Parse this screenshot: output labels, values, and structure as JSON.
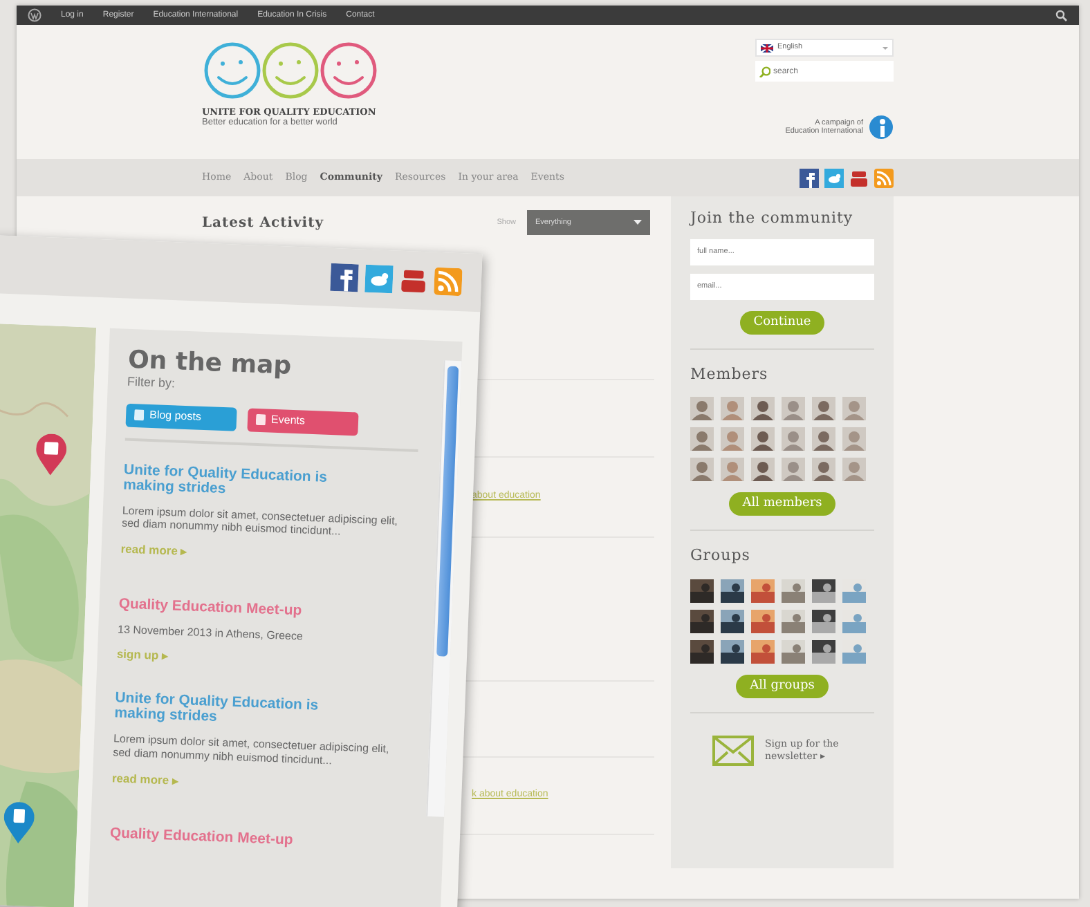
{
  "top_bar": {
    "links": [
      "Log in",
      "Register",
      "Education International",
      "Education In Crisis",
      "Contact"
    ]
  },
  "header": {
    "logo_title": "UNITE FOR QUALITY EDUCATION",
    "logo_tagline": "Better education for a better world",
    "language": "English",
    "search": {
      "placeholder": "search"
    },
    "campaign": [
      "A campaign of",
      "Education International"
    ]
  },
  "nav": [
    {
      "label": "Home",
      "selected": false
    },
    {
      "label": "About",
      "selected": false
    },
    {
      "label": "Blog",
      "selected": false
    },
    {
      "label": "Community",
      "selected": true
    },
    {
      "label": "Resources",
      "selected": false
    },
    {
      "label": "In your area",
      "selected": false
    },
    {
      "label": "Events",
      "selected": false
    }
  ],
  "main": {
    "title": "Latest Activity",
    "show_label": "Show",
    "show_value": "Everything",
    "activity": [
      {
        "text": "about education"
      },
      {
        "text": "k about education"
      }
    ]
  },
  "sidebar": {
    "join": {
      "title": "Join the community",
      "fields": [
        {
          "placeholder": "full name..."
        },
        {
          "placeholder": "email..."
        }
      ],
      "button": "Continue"
    },
    "members": {
      "title": "Members",
      "avatars": [
        {
          "kind": "avatar"
        },
        {
          "kind": "avatar"
        },
        {
          "kind": "avatar"
        },
        {
          "kind": "avatar"
        },
        {
          "kind": "avatar"
        },
        {
          "kind": "avatar"
        },
        {
          "kind": "avatar"
        },
        {
          "kind": "avatar"
        },
        {
          "kind": "avatar"
        },
        {
          "kind": "avatar"
        },
        {
          "kind": "avatar"
        },
        {
          "kind": "avatar"
        },
        {
          "kind": "avatar"
        },
        {
          "kind": "avatar"
        },
        {
          "kind": "avatar"
        },
        {
          "kind": "avatar"
        },
        {
          "kind": "avatar"
        },
        {
          "kind": "avatar"
        }
      ],
      "button": "All members"
    },
    "groups": {
      "title": "Groups",
      "button": "All groups"
    },
    "newsletter": "Sign up for the newsletter ▸"
  },
  "mobile_overlay": {
    "title": "On the map",
    "filter_label": "Filter by:",
    "filters": [
      {
        "label": "Blog posts",
        "kind": "blog"
      },
      {
        "label": "Events",
        "kind": "event"
      }
    ],
    "items": [
      {
        "kind": "post",
        "title": "Unite for Quality Education is making strides",
        "text": "Lorem ipsum dolor sit amet, consectetuer adipiscing elit, sed diam nonummy nibh euismod tincidunt...",
        "link": "read more ▸"
      },
      {
        "kind": "event",
        "title": "Quality Education Meet-up",
        "text": "13 November 2013 in Athens, Greece",
        "link": "sign up ▸"
      },
      {
        "kind": "post",
        "title": "Unite for Quality Education is making strides",
        "text": "Lorem ipsum dolor sit amet, consectetuer adipiscing elit, sed diam nonummy nibh euismod tincidunt...",
        "link": "read more ▸"
      },
      {
        "kind": "event",
        "title": "Quality Education Meet-up"
      }
    ]
  }
}
